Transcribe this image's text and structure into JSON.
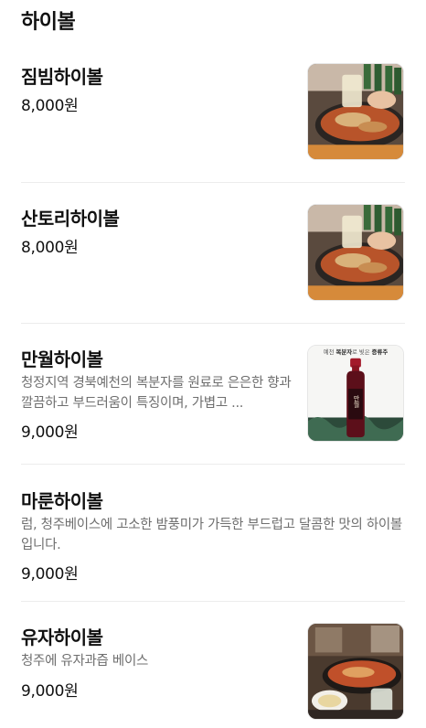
{
  "section": {
    "title": "하이볼"
  },
  "items": [
    {
      "name": "짐빔하이볼",
      "description": "",
      "price": "8,000원",
      "image": "highball-with-spicy-dish-photo"
    },
    {
      "name": "산토리하이볼",
      "description": "",
      "price": "8,000원",
      "image": "highball-with-spicy-dish-photo"
    },
    {
      "name": "만월하이볼",
      "description": "청정지역 경북예천의 복분자를 원료로 은은한 향과 깔끔하고 부드러움이 특징이며, 가볍고 ...",
      "price": "9,000원",
      "image": "bokbunja-liquor-bottle-photo"
    },
    {
      "name": "마룬하이볼",
      "description": "럼, 청주베이스에 고소한 밤풍미가 가득한 부드럽고 달콤한 맛의 하이볼입니다.",
      "price": "9,000원",
      "image": ""
    },
    {
      "name": "유자하이볼",
      "description": "청주에 유자과즙 베이스",
      "price": "9,000원",
      "image": "table-dish-and-drink-photo"
    }
  ],
  "poster": {
    "top_text_prefix": "예천",
    "top_text_highlight": "복분자",
    "top_text_middle": "로 빚은",
    "top_text_suffix": "증류주",
    "bottle_label": "만월"
  },
  "colors": {
    "text": "#111111",
    "muted": "#6f6f6f",
    "divider": "#ececec"
  }
}
